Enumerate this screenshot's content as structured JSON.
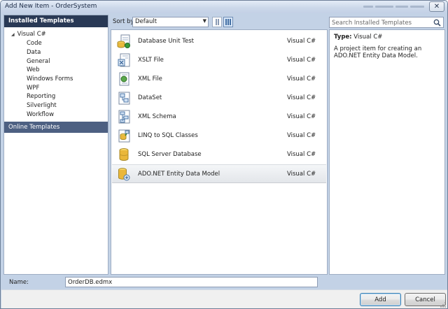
{
  "window": {
    "title": "Add New Item - OrderSystem",
    "close_glyph": "✕"
  },
  "left_panel": {
    "header": "Installed Templates",
    "root": {
      "label": "Visual C#",
      "expander_glyph": "◢"
    },
    "items": [
      "Code",
      "Data",
      "General",
      "Web",
      "Windows Forms",
      "WPF",
      "Reporting",
      "Silverlight",
      "Workflow"
    ],
    "online": "Online Templates"
  },
  "toolbar": {
    "sort_label": "Sort by:",
    "sort_value": "Default",
    "sort_arrow": "▼",
    "view_icons": [
      "medium-icons-view-icon",
      "list-view-icon"
    ]
  },
  "templates": [
    {
      "name": "Database Unit Test",
      "type": "Visual C#",
      "icon": "database-unit-test-icon"
    },
    {
      "name": "XSLT File",
      "type": "Visual C#",
      "icon": "xslt-file-icon"
    },
    {
      "name": "XML File",
      "type": "Visual C#",
      "icon": "xml-file-icon"
    },
    {
      "name": "DataSet",
      "type": "Visual C#",
      "icon": "dataset-icon"
    },
    {
      "name": "XML Schema",
      "type": "Visual C#",
      "icon": "xml-schema-icon"
    },
    {
      "name": "LINQ to SQL Classes",
      "type": "Visual C#",
      "icon": "linq-to-sql-icon"
    },
    {
      "name": "SQL Server Database",
      "type": "Visual C#",
      "icon": "sql-database-icon"
    },
    {
      "name": "ADO.NET Entity Data Model",
      "type": "Visual C#",
      "icon": "entity-data-model-icon",
      "selected": true
    }
  ],
  "search": {
    "placeholder": "Search Installed Templates"
  },
  "details": {
    "type_label": "Type:",
    "type_value": "Visual C#",
    "description": "A project item for creating an ADO.NET Entity Data Model."
  },
  "name_field": {
    "label": "Name:",
    "value": "OrderDB.edmx"
  },
  "buttons": {
    "add": "Add",
    "cancel": "Cancel"
  },
  "colors": {
    "header_bg": "#293955",
    "online_bg": "#4d6082",
    "dialog_bg": "#c3d2e6",
    "selected_row": "#e6e9ed"
  }
}
